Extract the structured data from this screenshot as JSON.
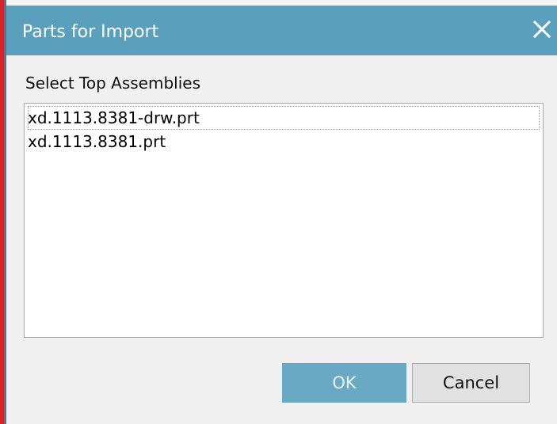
{
  "dialog": {
    "title": "Parts for Import"
  },
  "section": {
    "label": "Select Top Assemblies"
  },
  "list": {
    "items": [
      {
        "label": "xd.1113.8381-drw.prt"
      },
      {
        "label": "xd.1113.8381.prt"
      }
    ]
  },
  "buttons": {
    "ok_label": "OK",
    "cancel_label": "Cancel"
  },
  "colors": {
    "titlebar": "#5aa0bc",
    "ok_button": "#6aa9c3",
    "left_edge": "#d8232a"
  },
  "icons": {
    "close": "close-icon"
  }
}
